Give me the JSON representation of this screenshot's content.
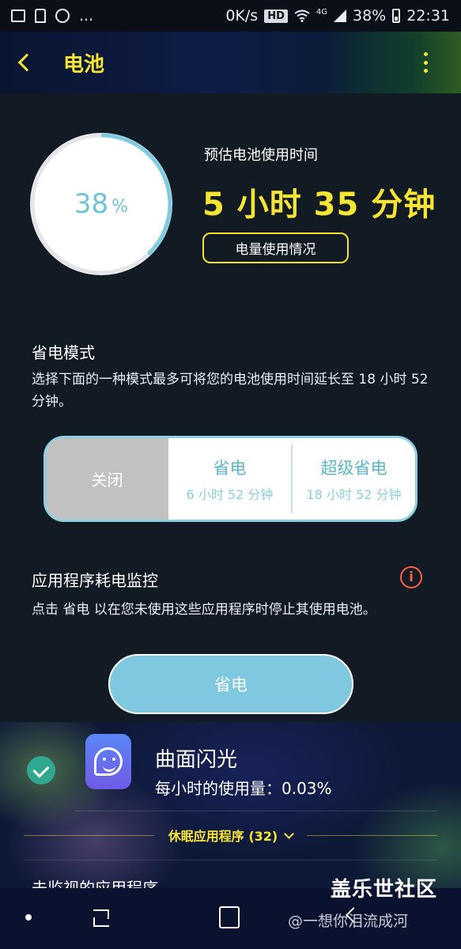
{
  "status_bar": {
    "network_speed": "0K/s",
    "hd_badge": "HD",
    "network_type": "4G",
    "battery_pct": "38%",
    "time": "22:31",
    "overflow_dots": "..."
  },
  "app_bar": {
    "title": "电池"
  },
  "battery": {
    "level_fraction": 0.38,
    "percent_value": "38",
    "percent_unit": "%",
    "estimate_label": "预估电池使用时间",
    "estimate_time": "5 小时 35 分钟",
    "usage_button": "电量使用情况",
    "ring_color": "#7fcbe0"
  },
  "power_saving": {
    "title": "省电模式",
    "description": "选择下面的一种模式最多可将您的电池使用时间延长至 18 小时 52 分钟。",
    "modes": [
      {
        "label": "关闭"
      },
      {
        "label": "省电",
        "time": "6 小时 52 分钟"
      },
      {
        "label": "超级省电",
        "time": "18 小时 52 分钟"
      }
    ]
  },
  "app_monitor": {
    "title": "应用程序耗电监控",
    "info_glyph": "i",
    "description": "点击 省电 以在您未使用这些应用程序时停止其使用电池。",
    "save_button": "省电"
  },
  "app_list": {
    "items": [
      {
        "name": "曲面闪光",
        "usage": "每小时的使用量：0.03%"
      }
    ],
    "sleeping_label": "休眠应用程序 (32)",
    "unmonitored_label": "未监视的应用程序"
  },
  "watermark": {
    "brand": "盖乐世社区",
    "user": "@一想你泪流成河"
  },
  "colors": {
    "accent_yellow": "#f6e533",
    "accent_teal": "#7fc8df",
    "check_green": "#2fa88f",
    "info_red": "#ff5d45"
  }
}
